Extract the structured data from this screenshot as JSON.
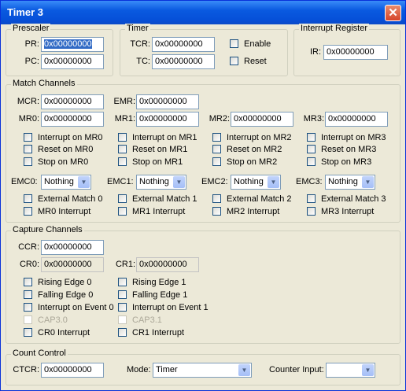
{
  "window": {
    "title": "Timer 3",
    "close_glyph": "✕"
  },
  "prescaler": {
    "label": "Prescaler",
    "pr_label": "PR:",
    "pr_value": "0x00000000",
    "pc_label": "PC:",
    "pc_value": "0x00000000"
  },
  "timer": {
    "label": "Timer",
    "tcr_label": "TCR:",
    "tcr_value": "0x00000000",
    "tc_label": "TC:",
    "tc_value": "0x00000000",
    "enable_label": "Enable",
    "reset_label": "Reset"
  },
  "interrupt_register": {
    "label": "Interrupt Register",
    "ir_label": "IR:",
    "ir_value": "0x00000000"
  },
  "match": {
    "label": "Match Channels",
    "mcr_label": "MCR:",
    "mcr_value": "0x00000000",
    "emr_label": "EMR:",
    "emr_value": "0x00000000",
    "channels": [
      {
        "mr_label": "MR0:",
        "mr_value": "0x00000000",
        "interrupt": "Interrupt on MR0",
        "reset": "Reset on MR0",
        "stop": "Stop on MR0",
        "emc_label": "EMC0:",
        "emc_value": "Nothing",
        "ext": "External Match 0",
        "mrint": "MR0 Interrupt"
      },
      {
        "mr_label": "MR1:",
        "mr_value": "0x00000000",
        "interrupt": "Interrupt on MR1",
        "reset": "Reset on MR1",
        "stop": "Stop on MR1",
        "emc_label": "EMC1:",
        "emc_value": "Nothing",
        "ext": "External Match 1",
        "mrint": "MR1 Interrupt"
      },
      {
        "mr_label": "MR2:",
        "mr_value": "0x00000000",
        "interrupt": "Interrupt on MR2",
        "reset": "Reset on MR2",
        "stop": "Stop on MR2",
        "emc_label": "EMC2:",
        "emc_value": "Nothing",
        "ext": "External Match 2",
        "mrint": "MR2 Interrupt"
      },
      {
        "mr_label": "MR3:",
        "mr_value": "0x00000000",
        "interrupt": "Interrupt on MR3",
        "reset": "Reset on MR3",
        "stop": "Stop on MR3",
        "emc_label": "EMC3:",
        "emc_value": "Nothing",
        "ext": "External Match 3",
        "mrint": "MR3 Interrupt"
      }
    ]
  },
  "capture": {
    "label": "Capture Channels",
    "ccr_label": "CCR:",
    "ccr_value": "0x00000000",
    "cr0_label": "CR0:",
    "cr0_value": "0x00000000",
    "cr1_label": "CR1:",
    "cr1_value": "0x00000000",
    "ch0": {
      "rising": "Rising Edge 0",
      "falling": "Falling Edge 0",
      "event": "Interrupt on Event 0",
      "cap": "CAP3.0",
      "crint": "CR0 Interrupt"
    },
    "ch1": {
      "rising": "Rising Edge 1",
      "falling": "Falling Edge 1",
      "event": "Interrupt on Event 1",
      "cap": "CAP3.1",
      "crint": "CR1 Interrupt"
    }
  },
  "count": {
    "label": "Count Control",
    "ctcr_label": "CTCR:",
    "ctcr_value": "0x00000000",
    "mode_label": "Mode:",
    "mode_value": "Timer",
    "input_label": "Counter Input:",
    "input_value": ""
  }
}
